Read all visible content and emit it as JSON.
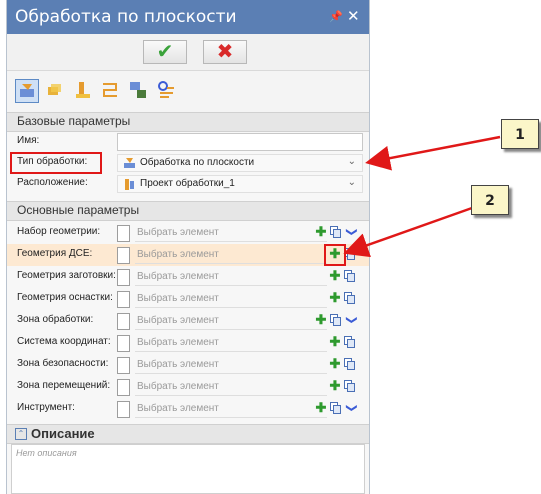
{
  "panel": {
    "title": "Обработка по плоскости",
    "pin_icon": "pin-icon",
    "close_icon": "close-icon",
    "ok_icon": "checkmark-icon",
    "cancel_icon": "cross-icon"
  },
  "toolbar": [
    "strategy-icon",
    "parameters-icon",
    "tool-icon",
    "path-icon",
    "simulation-icon",
    "settings-icon"
  ],
  "basic": {
    "header": "Базовые параметры",
    "name_label": "Имя:",
    "name_value": "",
    "type_label": "Тип обработки:",
    "type_value": "Обработка по плоскости",
    "location_label": "Расположение:",
    "location_value": "Проект обработки_1"
  },
  "main": {
    "header": "Основные параметры",
    "placeholder": "Выбрать элемент",
    "rows": [
      {
        "label": "Набор геометрии:"
      },
      {
        "label": "Геометрия ДСЕ:"
      },
      {
        "label": "Геометрия заготовки:"
      },
      {
        "label": "Геометрия оснастки:"
      },
      {
        "label": "Зона обработки:"
      },
      {
        "label": "Система координат:"
      },
      {
        "label": "Зона безопасности:"
      },
      {
        "label": "Зона перемещений:"
      },
      {
        "label": "Инструмент:"
      }
    ]
  },
  "description": {
    "header": "Описание",
    "placeholder": "Нет описания"
  },
  "callouts": {
    "one": "1",
    "two": "2"
  },
  "colors": {
    "title_bar": "#5b7fb4",
    "accent_red": "#e01818",
    "callout_bg": "#fbf6c9",
    "highlight_row": "#fde9d2"
  }
}
